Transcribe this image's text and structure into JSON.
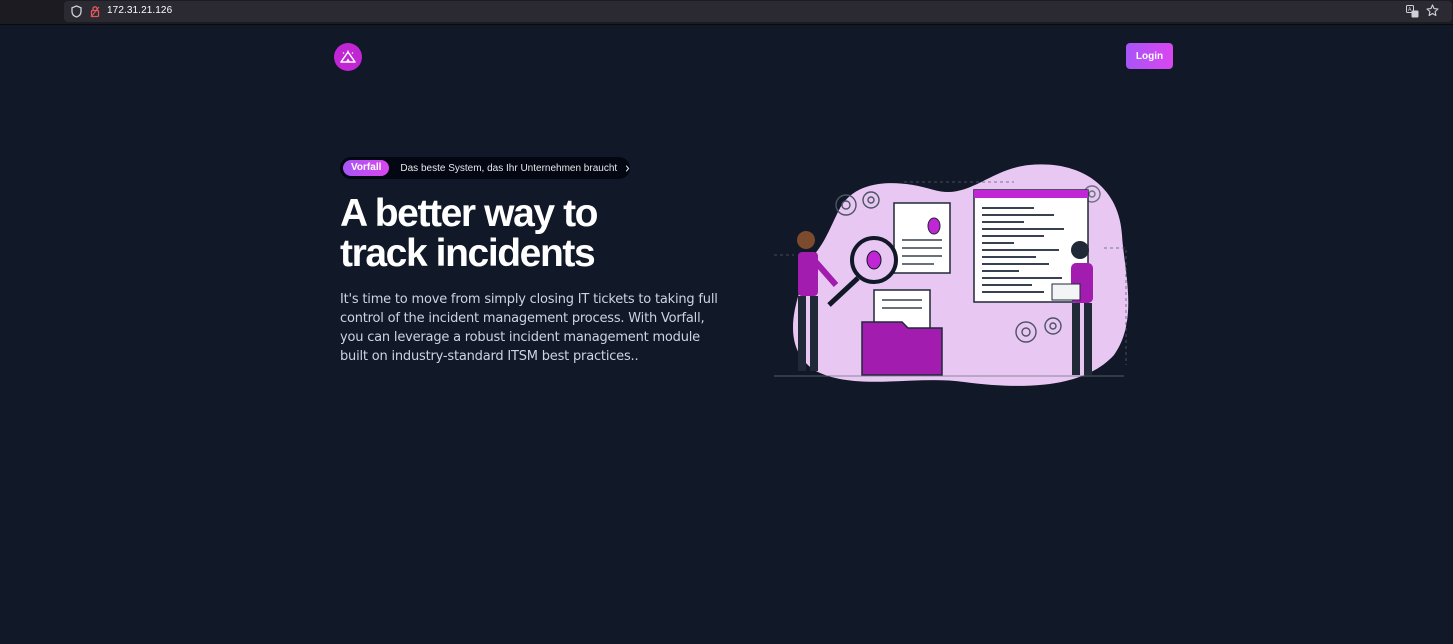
{
  "browser": {
    "url": "172.31.21.126",
    "icons": [
      "shield-icon",
      "lock-icon",
      "translate-icon",
      "star-icon"
    ]
  },
  "nav": {
    "logo_icon": "tent-logo-icon",
    "login_label": "Login"
  },
  "hero": {
    "badge": "Vorfall",
    "announcement": "Das beste System, das Ihr Unternehmen braucht",
    "title_line1": "A better way to",
    "title_line2": "track incidents",
    "description": "It's time to move from simply closing IT tickets to taking full control of the incident management process. With Vorfall, you can leverage a robust incident management module built on industry-standard ITSM best practices.."
  },
  "colors": {
    "background": "#111827",
    "accent": "#c026d3",
    "accent_gradient_start": "#a855f7",
    "accent_gradient_end": "#d946ef",
    "illustration_blob": "#e9c7f3"
  }
}
